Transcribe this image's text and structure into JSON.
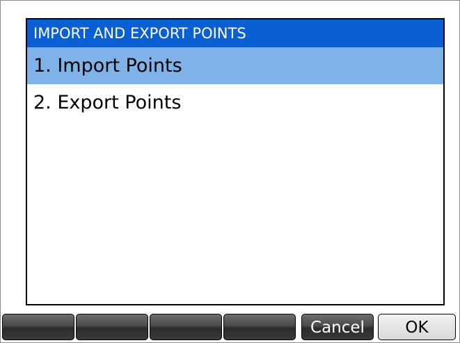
{
  "dialog": {
    "title": "IMPORT AND EXPORT POINTS",
    "items": [
      {
        "label": "1. Import Points",
        "selected": true
      },
      {
        "label": "2. Export Points",
        "selected": false
      }
    ]
  },
  "softkeys": [
    "",
    "",
    "",
    "",
    "Cancel",
    "OK"
  ],
  "colors": {
    "title_bar": "#0a5fd3",
    "selection": "#7fb2e8",
    "softkey_dark": "#3a3a3a"
  }
}
